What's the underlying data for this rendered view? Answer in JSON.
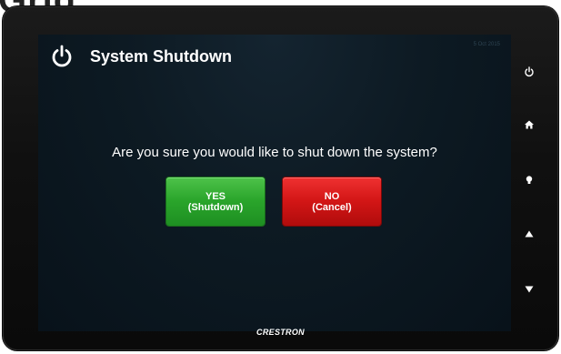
{
  "background_heading": "Grid",
  "dialog": {
    "title": "System Shutdown",
    "date": "5 Oct 2015",
    "question": "Are you sure you would like to shut down the system?",
    "yes_button": {
      "line1": "YES",
      "line2": "(Shutdown)",
      "color": "#2aa52b"
    },
    "no_button": {
      "line1": "NO",
      "line2": "(Cancel)",
      "color": "#d31616"
    }
  },
  "side_buttons": [
    "power-icon",
    "home-icon",
    "lightbulb-icon",
    "arrow-up-icon",
    "arrow-down-icon"
  ],
  "brand": "CRESTRON"
}
